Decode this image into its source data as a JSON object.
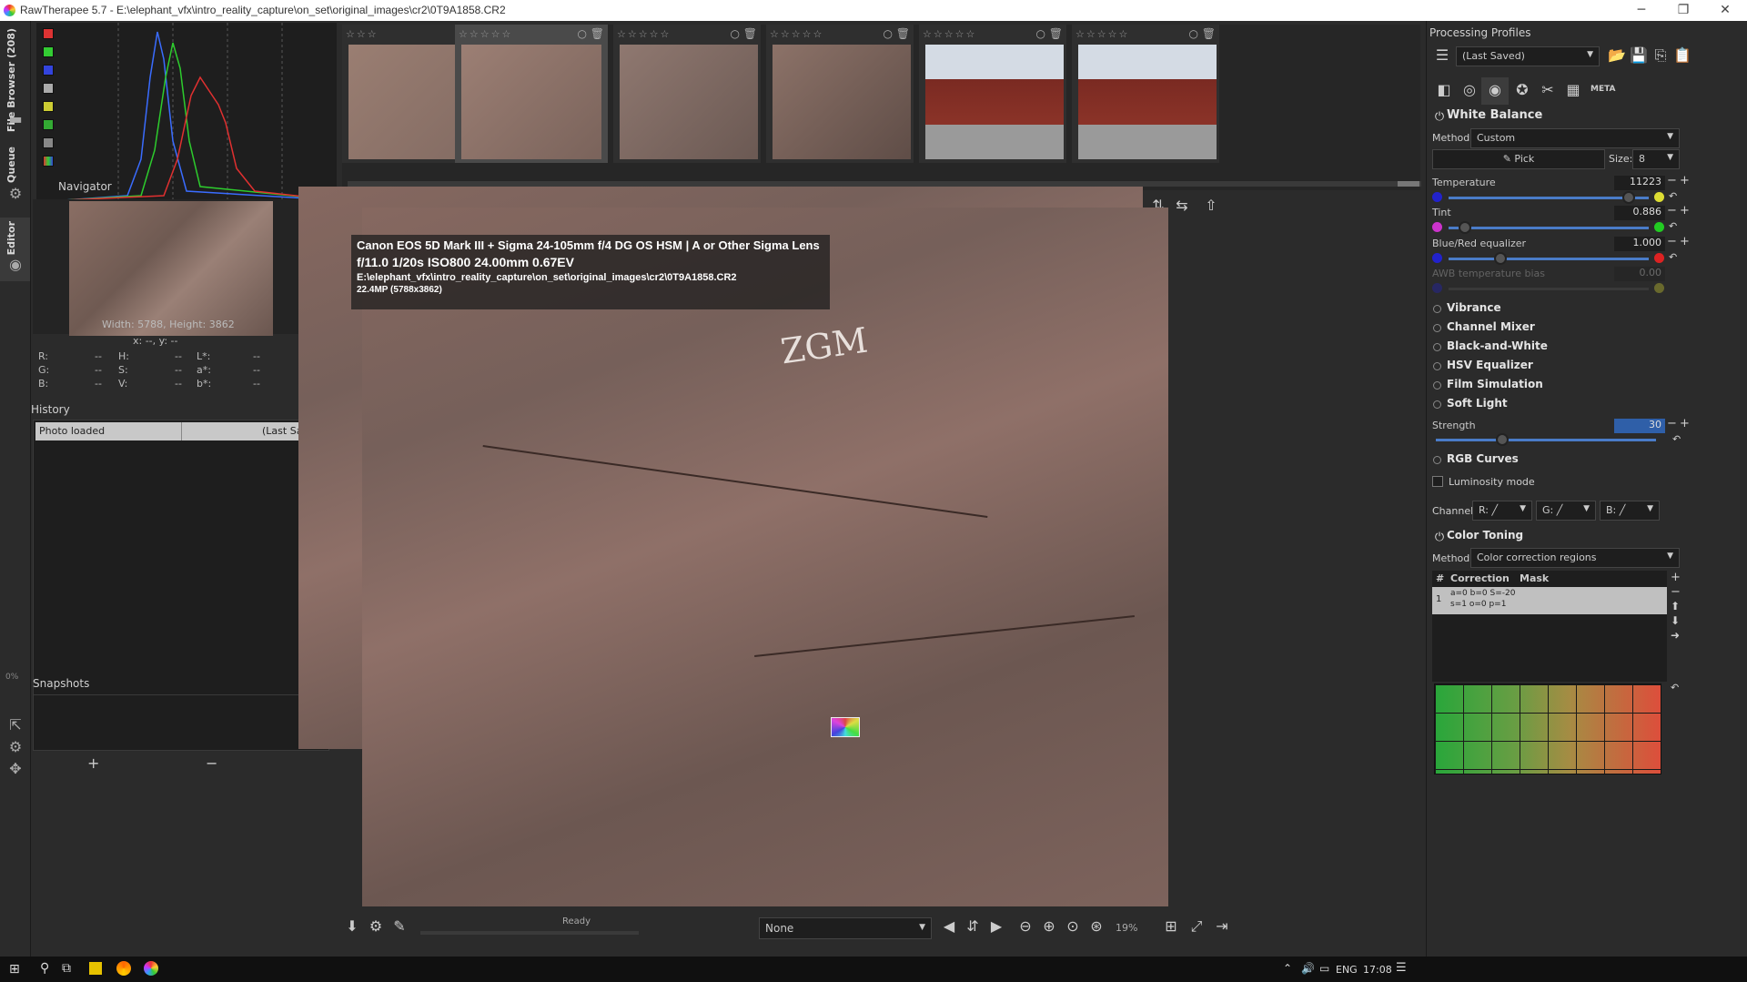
{
  "window": {
    "title": "RawTherapee 5.7 - E:\\elephant_vfx\\intro_reality_capture\\on_set\\original_images\\cr2\\0T9A1858.CR2",
    "minimize": "─",
    "maximize": "❐",
    "close": "✕"
  },
  "vtabs": {
    "file_browser": "File Browser (208)",
    "queue": "Queue",
    "editor": "Editor",
    "zero_percent": "0%"
  },
  "navigator": {
    "title": "Navigator",
    "size": "Width: 5788, Height: 3862",
    "xy": "x: --, y: --",
    "rows": [
      {
        "a": "R:",
        "av": "--",
        "b": "H:",
        "bv": "--",
        "c": "L*:",
        "cv": "--"
      },
      {
        "a": "G:",
        "av": "--",
        "b": "S:",
        "bv": "--",
        "c": "a*:",
        "cv": "--"
      },
      {
        "a": "B:",
        "av": "--",
        "b": "V:",
        "bv": "--",
        "c": "b*:",
        "cv": "--"
      }
    ]
  },
  "history": {
    "title": "History",
    "row_left": "Photo loaded",
    "row_right": "(Last Saved)"
  },
  "snapshots": {
    "title": "Snapshots",
    "add": "+",
    "remove": "−"
  },
  "filmstrip": {
    "stars": "☆☆☆☆☆",
    "stars_short": "☆☆☆",
    "icons": "○ 🗑"
  },
  "overlay": {
    "line1": "Canon EOS 5D Mark III + Sigma 24-105mm f/4 DG OS HSM | A or Other Sigma Lens",
    "line2": "f/11.0  1/20s  ISO800  24.00mm  0.67EV",
    "line3": "E:\\elephant_vfx\\intro_reality_capture\\on_set\\original_images\\cr2\\0T9A1858.CR2",
    "line4": "22.4MP (5788x3862)"
  },
  "image": {
    "graffiti": "ZGM"
  },
  "bottombar": {
    "status": "Ready",
    "combo": "None",
    "zoom": "19%"
  },
  "right": {
    "profiles_title": "Processing Profiles",
    "profile_value": "(Last Saved)",
    "tool_meta": "META",
    "white_balance": {
      "title": "White Balance",
      "method_label": "Method:",
      "method_value": "Custom",
      "pick": "Pick",
      "size_label": "Size:",
      "size_value": "8",
      "temperature_label": "Temperature",
      "temperature_value": "11223",
      "temperature_level": 0.9,
      "tint_label": "Tint",
      "tint_value": "0.886",
      "tint_level": 0.08,
      "bre_label": "Blue/Red equalizer",
      "bre_value": "1.000",
      "bre_level": 0.26,
      "awb_label": "AWB temperature bias",
      "awb_value": "0.00"
    },
    "tools": [
      "Vibrance",
      "Channel Mixer",
      "Black-and-White",
      "HSV Equalizer",
      "Film Simulation",
      "Soft Light"
    ],
    "soft_light": {
      "strength_label": "Strength",
      "strength_value": "30",
      "strength_level": 0.3
    },
    "rgb_curves": {
      "title": "RGB Curves",
      "luminosity": "Luminosity mode",
      "channel_label": "Channel:",
      "r": "R:",
      "g": "G:",
      "b": "B:"
    },
    "color_toning": {
      "title": "Color Toning",
      "method_label": "Method",
      "method_value": "Color correction regions",
      "col_num": "#",
      "col_correction": "Correction",
      "col_mask": "Mask",
      "row_num": "1",
      "row_line1": "a=0 b=0 S=-20",
      "row_line2": "s=1 o=0 p=1"
    }
  },
  "taskbar": {
    "lang": "ENG",
    "time": "17:08"
  },
  "colors": {
    "bg": "#2b2b2b",
    "panel": "#1e1e1e",
    "accent": "#4a7cc8"
  }
}
